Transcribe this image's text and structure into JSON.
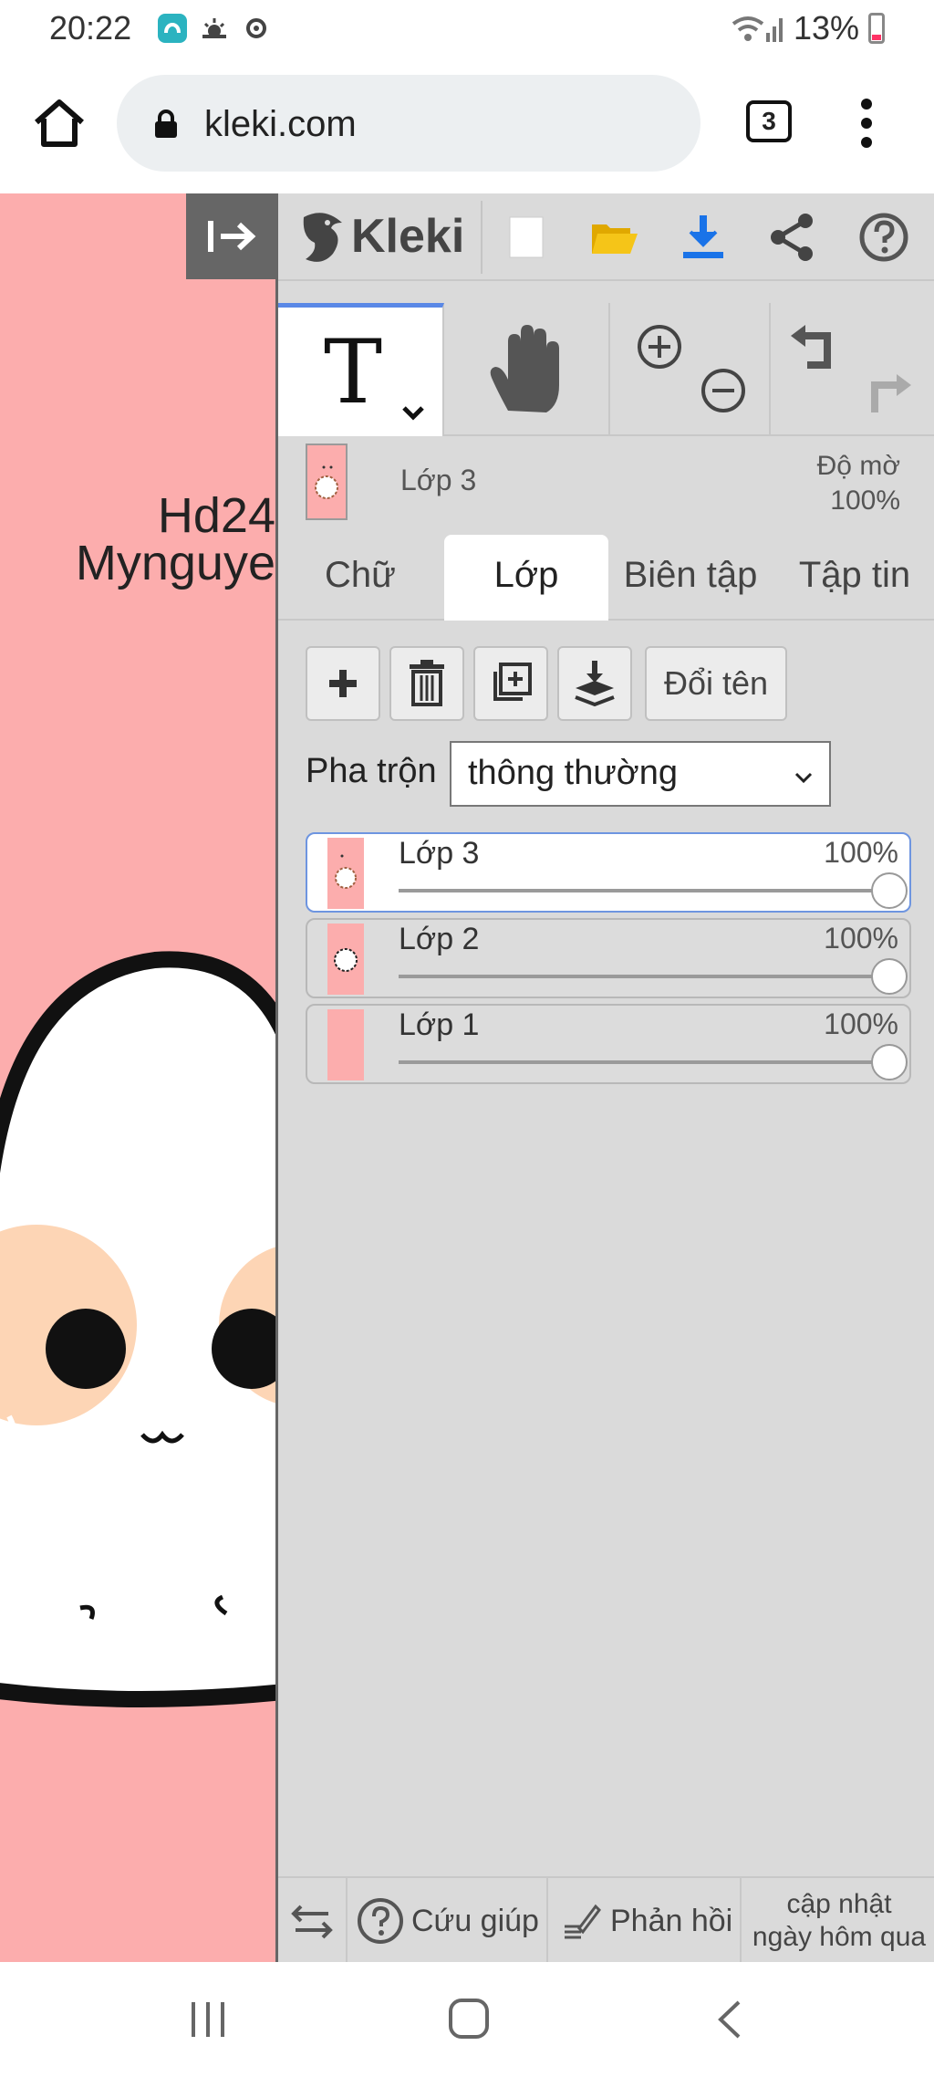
{
  "status": {
    "time": "20:22",
    "battery": "13%"
  },
  "browser": {
    "url": "kleki.com",
    "tab_count": "3"
  },
  "canvas": {
    "text_line1": "Hd24",
    "text_line2": "Mynguye"
  },
  "app": {
    "logo": "Kleki"
  },
  "layer_info": {
    "name": "Lớp 3",
    "opacity_label": "Độ mờ",
    "opacity_value": "100%"
  },
  "tabs": [
    {
      "label": "Chữ"
    },
    {
      "label": "Lớp"
    },
    {
      "label": "Biên tập"
    },
    {
      "label": "Tập tin"
    }
  ],
  "layer_panel": {
    "rename_label": "Đổi tên",
    "blend_label": "Pha trộn",
    "blend_value": "thông thường"
  },
  "layers": [
    {
      "name": "Lớp 3",
      "opacity": "100%",
      "opacity_fraction": 1.0
    },
    {
      "name": "Lớp 2",
      "opacity": "100%",
      "opacity_fraction": 1.0
    },
    {
      "name": "Lớp 1",
      "opacity": "100%",
      "opacity_fraction": 1.0
    }
  ],
  "footer": {
    "help_label": "Cứu giúp",
    "feedback_label": "Phản hồi",
    "update_line1": "cập nhật",
    "update_line2": "ngày hôm qua"
  },
  "colors": {
    "canvas_bg": "#fcadad",
    "panel_bg": "#dadada",
    "accent": "#5a88e6",
    "download": "#1a73e8",
    "folder": "#f5c518"
  }
}
